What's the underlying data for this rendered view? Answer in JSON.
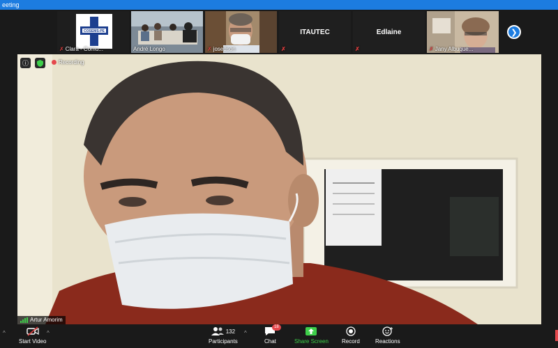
{
  "window": {
    "title": "eeting"
  },
  "gallery": {
    "tiles": [
      {
        "name": "Clara - Comu...",
        "muted": true,
        "logo_text": "COSEMS-PE"
      },
      {
        "name": "André Longo",
        "muted": false
      },
      {
        "name": "josedson",
        "muted": true
      },
      {
        "name": "",
        "muted": true,
        "display_text": "ITAUTEC"
      },
      {
        "name": "",
        "muted": true,
        "display_text": "Edlaine"
      },
      {
        "name": "Jany Albuque...",
        "muted": true
      }
    ],
    "next_icon": "chevron-right-icon"
  },
  "main_video": {
    "recording_label": "Recording",
    "speaker_name": "Artur Amorim",
    "colors": {
      "wall": "#e8e2cc",
      "shirt": "#8a2a1c",
      "mask": "#e9ecef"
    }
  },
  "toolbar": {
    "start_video_label": "Start Video",
    "participants_label": "Participants",
    "participants_count": "132",
    "chat_label": "Chat",
    "chat_badge": "18",
    "share_screen_label": "Share Screen",
    "record_label": "Record",
    "reactions_label": "Reactions"
  },
  "colors": {
    "accent": "#1c7ce0",
    "share_green": "#3ecf4a",
    "muted_red": "#e04040"
  }
}
